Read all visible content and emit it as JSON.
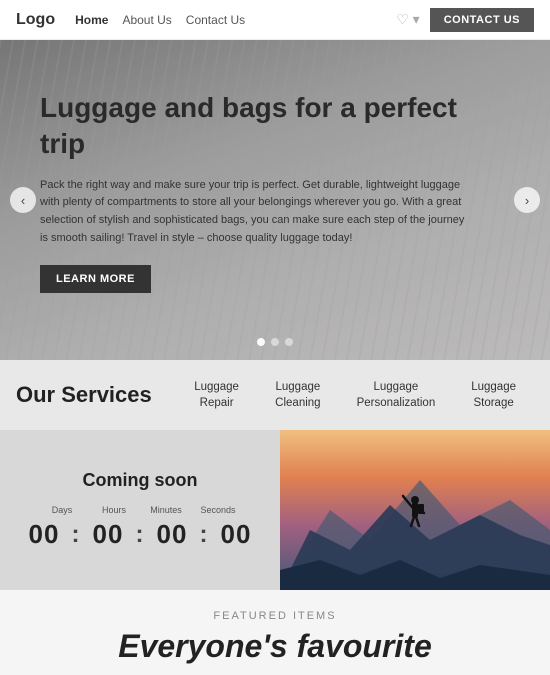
{
  "navbar": {
    "logo": "Logo",
    "links": [
      "Home",
      "About Us",
      "Contact Us"
    ],
    "contact_button": "CONTACT US"
  },
  "hero": {
    "title": "Luggage and bags for a perfect trip",
    "description": "Pack the right way and make sure your trip is perfect. Get durable, lightweight luggage with plenty of compartments to store all your belongings wherever you go. With a great selection of stylish and sophisticated bags, you can make sure each step of the journey is smooth sailing! Travel in style – choose quality luggage today!",
    "learn_more": "LEARN MORE",
    "dots": [
      1,
      2,
      3
    ],
    "active_dot": 1
  },
  "services": {
    "title": "Our Services",
    "items": [
      {
        "label": "Luggage Repair"
      },
      {
        "label": "Luggage\nCleaning"
      },
      {
        "label": "Luggage\nPersonalization"
      },
      {
        "label": "Luggage\nStorage"
      }
    ]
  },
  "countdown": {
    "title": "Coming soon",
    "labels": [
      "Days",
      "Hours",
      "Minutes",
      "Seconds"
    ],
    "values": [
      "00",
      "00",
      "00",
      "00"
    ]
  },
  "featured": {
    "label": "FEATURED ITEMS",
    "heading": "Everyone's favourite"
  }
}
